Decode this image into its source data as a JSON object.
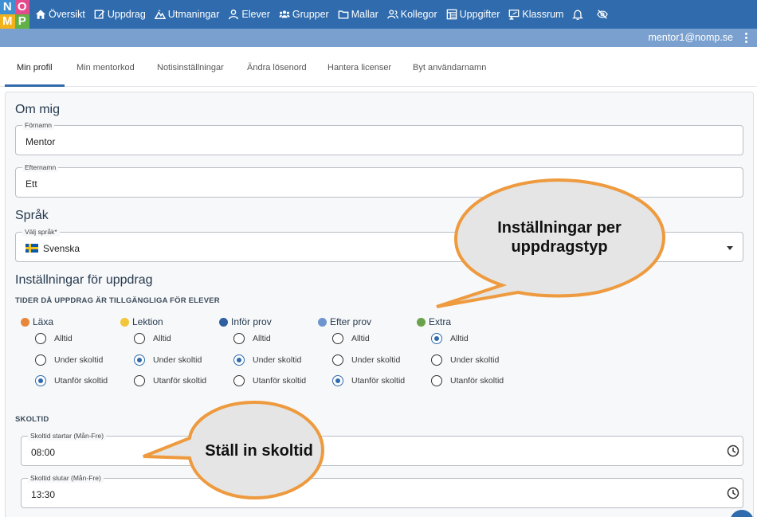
{
  "logo": {
    "letters": [
      "N",
      "O",
      "M",
      "P"
    ],
    "colors": [
      "#3d8fd4",
      "#e34c8c",
      "#f3b21b",
      "#61b145"
    ]
  },
  "nav": {
    "items": [
      {
        "label": "Översikt",
        "icon": "home-icon"
      },
      {
        "label": "Uppdrag",
        "icon": "edit-icon"
      },
      {
        "label": "Utmaningar",
        "icon": "mountain-icon"
      },
      {
        "label": "Elever",
        "icon": "person-icon"
      },
      {
        "label": "Grupper",
        "icon": "group-icon"
      },
      {
        "label": "Mallar",
        "icon": "folder-icon"
      },
      {
        "label": "Kollegor",
        "icon": "colleagues-icon"
      },
      {
        "label": "Uppgifter",
        "icon": "tasks-icon"
      },
      {
        "label": "Klassrum",
        "icon": "classroom-icon"
      }
    ],
    "extra_icons": [
      "bell-icon",
      "eye-off-icon"
    ]
  },
  "user": {
    "email": "mentor1@nomp.se"
  },
  "tabs": [
    "Min profil",
    "Min mentorkod",
    "Notisinställningar",
    "Ändra lösenord",
    "Hantera licenser",
    "Byt användarnamn"
  ],
  "profile": {
    "heading": "Om mig",
    "firstname_label": "Förnamn",
    "firstname_value": "Mentor",
    "lastname_label": "Efternamn",
    "lastname_value": "Ett"
  },
  "language": {
    "heading": "Språk",
    "label": "Välj språk*",
    "value": "Svenska"
  },
  "assignments": {
    "heading": "Inställningar för uppdrag",
    "subheading": "TIDER DÅ UPPDRAG ÄR TILLGÄNGLIGA FÖR ELEVER",
    "options": [
      "Alltid",
      "Under skoltid",
      "Utanför skoltid"
    ],
    "categories": [
      {
        "name": "Läxa",
        "color": "#e8873a",
        "selected": 2
      },
      {
        "name": "Lektion",
        "color": "#f2c63b",
        "selected": 1
      },
      {
        "name": "Inför prov",
        "color": "#2f5f9e",
        "selected": 1
      },
      {
        "name": "Efter prov",
        "color": "#6f95cf",
        "selected": 2
      },
      {
        "name": "Extra",
        "color": "#6aa24c",
        "selected": 0
      }
    ]
  },
  "schooltime": {
    "heading": "SKOLTID",
    "start_label": "Skoltid startar (Mån-Fre)",
    "start_value": "08:00",
    "end_label": "Skoltid slutar (Mån-Fre)",
    "end_value": "13:30"
  },
  "callouts": {
    "top_line1": "Inställningar per",
    "top_line2": "uppdragstyp",
    "bottom": "Ställ in skoltid"
  }
}
